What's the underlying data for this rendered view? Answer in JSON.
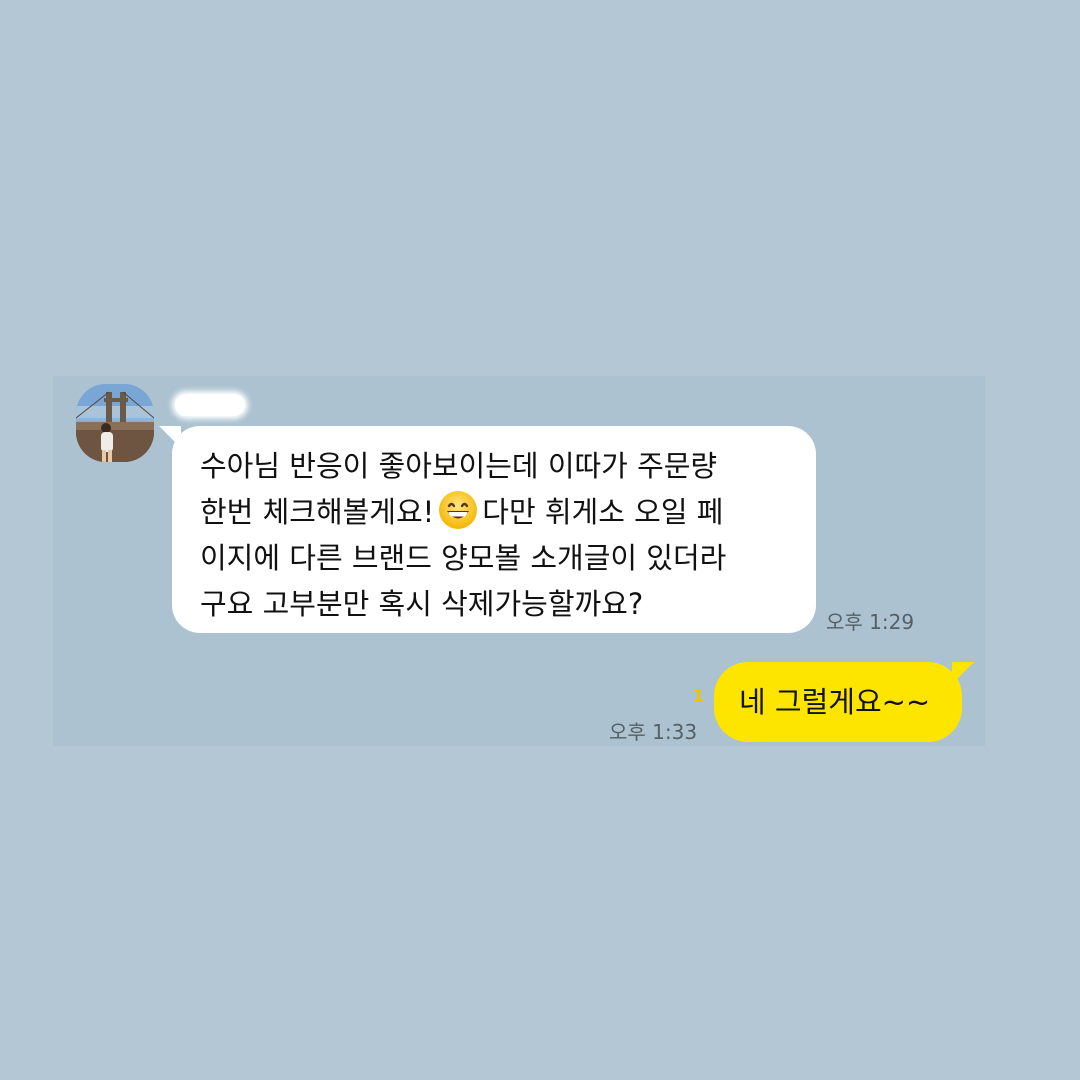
{
  "chat": {
    "incoming": {
      "sender_name": "",
      "lines": [
        "수아님 반응이 좋아보이는데 이따가 주문량",
        "한번 체크해볼게요!",
        "다만 휘게소 오일 페",
        "이지에 다른 브랜드 양모볼 소개글이 있더라",
        "구요 고부분만 혹시 삭제가능할까요?"
      ],
      "emoji": "grinning-face-icon",
      "time": "오후 1:29"
    },
    "outgoing": {
      "text": "네 그럴게요~~",
      "unread_count": "1",
      "time": "오후 1:33"
    }
  },
  "colors": {
    "background": "#b3c8d4",
    "chat_panel": "#acc2d0",
    "incoming_bubble": "#ffffff",
    "outgoing_bubble": "#fee500",
    "unread_count": "#e8c800"
  }
}
